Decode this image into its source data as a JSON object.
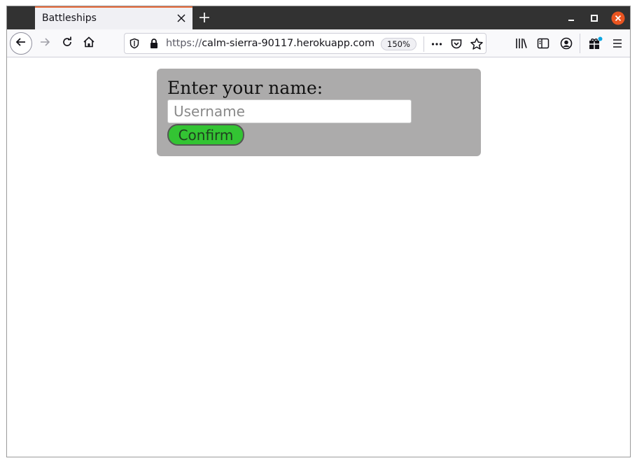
{
  "browser": {
    "tab_title": "Battleships",
    "url_scheme": "https://",
    "url_host": "calm-sierra-90117.herokuapp.com",
    "url_rest": "/",
    "zoom": "150%"
  },
  "page": {
    "prompt": "Enter your name:",
    "username_placeholder": "Username",
    "username_value": "",
    "confirm_label": "Confirm"
  },
  "colors": {
    "card_bg": "#acabab",
    "confirm_bg": "#33c433",
    "tab_accent": "#e66a3a",
    "close_button": "#e95420"
  },
  "icons": [
    "back-arrow-icon",
    "forward-arrow-icon",
    "reload-icon",
    "home-icon",
    "shield-icon",
    "lock-icon",
    "more-icon",
    "pocket-icon",
    "bookmark-star-icon",
    "library-icon",
    "sidebar-icon",
    "account-icon",
    "extensions-icon",
    "hamburger-menu-icon",
    "close-tab-icon",
    "new-tab-icon",
    "minimize-icon",
    "maximize-icon",
    "close-window-icon"
  ]
}
